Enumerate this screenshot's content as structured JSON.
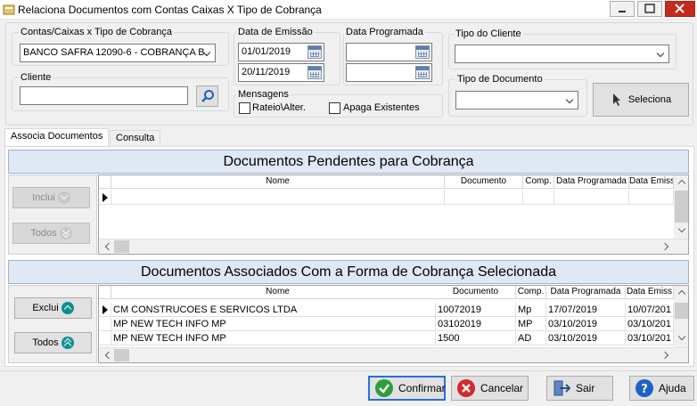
{
  "window": {
    "title": "Relaciona Documentos com Contas Caixas X Tipo de Cobrança"
  },
  "filters": {
    "contas_label": "Contas/Caixas x Tipo de Cobrança",
    "contas_value": "BANCO SAFRA 12090-6 - COBRANÇA B.",
    "cliente_label": "Cliente",
    "cliente_value": "",
    "data_emissao_label": "Data de Emissão",
    "data_emissao_inicio": "01/01/2019",
    "data_emissao_fim": "20/11/2019",
    "data_programada_label": "Data Programada",
    "data_programada_inicio": "",
    "data_programada_fim": "",
    "tipo_cliente_label": "Tipo do Cliente",
    "tipo_cliente_value": "",
    "tipo_documento_label": "Tipo de Documento",
    "tipo_documento_value": "",
    "mensagens_label": "Mensagens",
    "rateio_label": "Rateio\\Alter.",
    "apaga_label": "Apaga Existentes",
    "seleciona_label": "Seleciona"
  },
  "tabs": [
    {
      "label": "Associa Documentos"
    },
    {
      "label": "Consulta"
    }
  ],
  "pendentes": {
    "title": "Documentos Pendentes para Cobrança",
    "inclui_label": "Inclui",
    "todos_label": "Todos",
    "columns": [
      "Nome",
      "Documento",
      "Comp.",
      "Data Programada",
      "Data Emiss"
    ]
  },
  "associados": {
    "title": "Documentos Associados Com a Forma de Cobrança Selecionada",
    "exclui_label": "Exclui",
    "todos_label": "Todos",
    "columns": [
      "Nome",
      "Documento",
      "Comp.",
      "Data Programada",
      "Data Emiss"
    ],
    "rows": [
      [
        "CM CONSTRUCOES E SERVICOS LTDA",
        "10072019",
        "Mp",
        "17/07/2019",
        "10/07/201"
      ],
      [
        "MP NEW TECH INFO MP",
        "03102019",
        "MP",
        "03/10/2019",
        "03/10/201"
      ],
      [
        "MP NEW TECH INFO MP",
        "1500",
        "AD",
        "03/10/2019",
        "03/10/201"
      ]
    ]
  },
  "footer": {
    "confirmar": "Confirmar",
    "cancelar": "Cancelar",
    "sair": "Sair",
    "ajuda": "Ajuda"
  },
  "colors": {
    "header_bg": "#dfe8f5",
    "confirm_icon": "#2e9e3a",
    "cancel_icon": "#d22b2b",
    "help_icon": "#1e62c7",
    "teal_icon": "#0f8f8f"
  }
}
